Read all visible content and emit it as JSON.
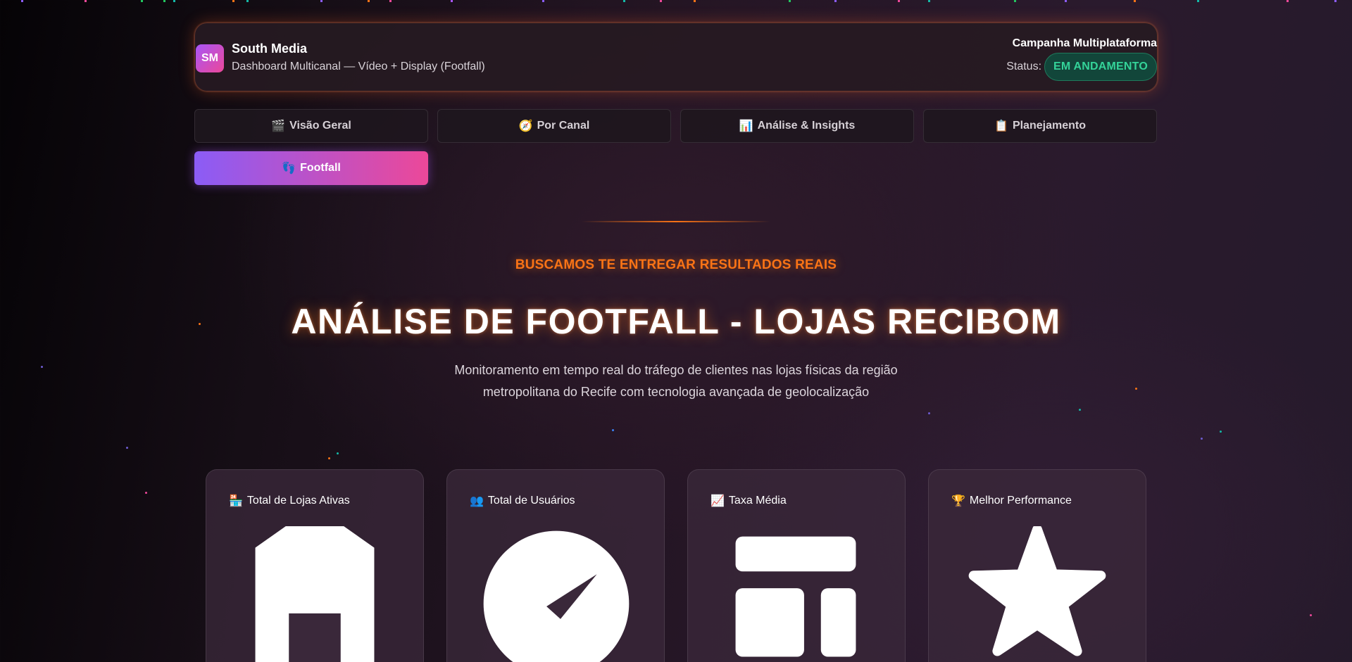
{
  "colors": {
    "accent_orange": "#f97316",
    "gradient_start": "#8b5cf6",
    "gradient_end": "#ec4899",
    "status_green": "#34d399"
  },
  "header": {
    "logo_text": "SM",
    "brand_name": "South Media",
    "brand_subtitle": "Dashboard Multicanal — Vídeo + Display (Footfall)",
    "campaign_title": "Campanha Multiplataforma",
    "status_label": "Status:",
    "status_value": "EM ANDAMENTO"
  },
  "tabs": [
    {
      "emoji": "🎬",
      "label": "Visão Geral",
      "active": false
    },
    {
      "emoji": "🧭",
      "label": "Por Canal",
      "active": false
    },
    {
      "emoji": "📊",
      "label": "Análise & Insights",
      "active": false
    },
    {
      "emoji": "📋",
      "label": "Planejamento",
      "active": false
    },
    {
      "emoji": "👣",
      "label": "Footfall",
      "active": true
    }
  ],
  "hero": {
    "eyebrow": "BUSCAMOS TE ENTREGAR RESULTADOS REAIS",
    "title": "ANÁLISE DE FOOTFALL - LOJAS RECIBOM",
    "description": "Monitoramento em tempo real do tráfego de clientes nas lojas físicas da região metropolitana do Recife com tecnologia avançada de geolocalização"
  },
  "cards": [
    {
      "emoji": "🏪",
      "label": "Total de Lojas Ativas",
      "icon": "house-icon"
    },
    {
      "emoji": "👥",
      "label": "Total de Usuários",
      "icon": "compass-icon"
    },
    {
      "emoji": "📈",
      "label": "Taxa Média",
      "icon": "layout-icon"
    },
    {
      "emoji": "🏆",
      "label": "Melhor Performance",
      "icon": "star-icon"
    }
  ]
}
